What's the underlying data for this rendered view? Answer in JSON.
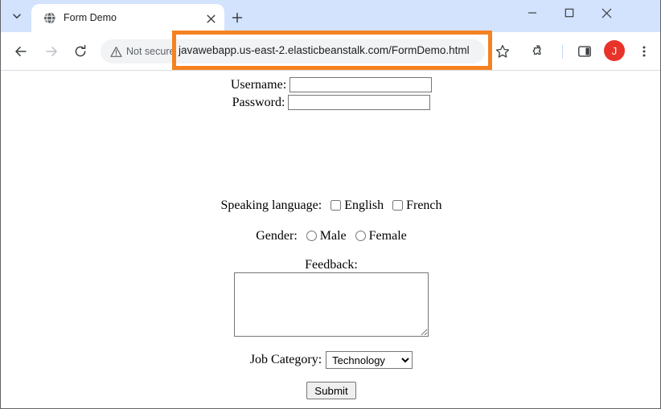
{
  "window": {
    "controls": {
      "minimize": "minimize-window",
      "maximize": "maximize-window",
      "close": "close-window"
    }
  },
  "tab_strip": {
    "tab_search_icon": "chevron-down-icon",
    "new_tab_icon": "plus-icon",
    "tabs": [
      {
        "title": "Form Demo",
        "favicon": "globe-icon",
        "close_icon": "close-icon",
        "active": true
      }
    ]
  },
  "toolbar": {
    "back_icon": "arrow-left-icon",
    "forward_icon": "arrow-right-icon",
    "reload_icon": "reload-icon",
    "security": {
      "icon": "warning-triangle-icon",
      "label": "Not secure"
    },
    "url": "javawebapp.us-east-2.elasticbeanstalk.com/FormDemo.html",
    "bookmark_icon": "star-icon",
    "extensions_icon": "puzzle-piece-icon",
    "side_panel_icon": "side-panel-icon",
    "profile": {
      "initial": "J",
      "color": "#e8332a"
    },
    "menu_icon": "three-dot-menu-icon"
  },
  "annotation": {
    "url_highlight_color": "#f58220"
  },
  "page": {
    "username": {
      "label": "Username:",
      "value": "",
      "placeholder": ""
    },
    "password": {
      "label": "Password:",
      "value": "",
      "placeholder": ""
    },
    "language": {
      "label": "Speaking language:",
      "options": [
        {
          "label": "English",
          "checked": false
        },
        {
          "label": "French",
          "checked": false
        }
      ]
    },
    "gender": {
      "label": "Gender:",
      "options": [
        {
          "label": "Male",
          "checked": false
        },
        {
          "label": "Female",
          "checked": false
        }
      ]
    },
    "feedback": {
      "label": "Feedback:",
      "value": "",
      "placeholder": ""
    },
    "job_category": {
      "label": "Job Category:",
      "selected": "Technology",
      "options": [
        "Technology"
      ]
    },
    "submit": {
      "label": "Submit"
    }
  }
}
